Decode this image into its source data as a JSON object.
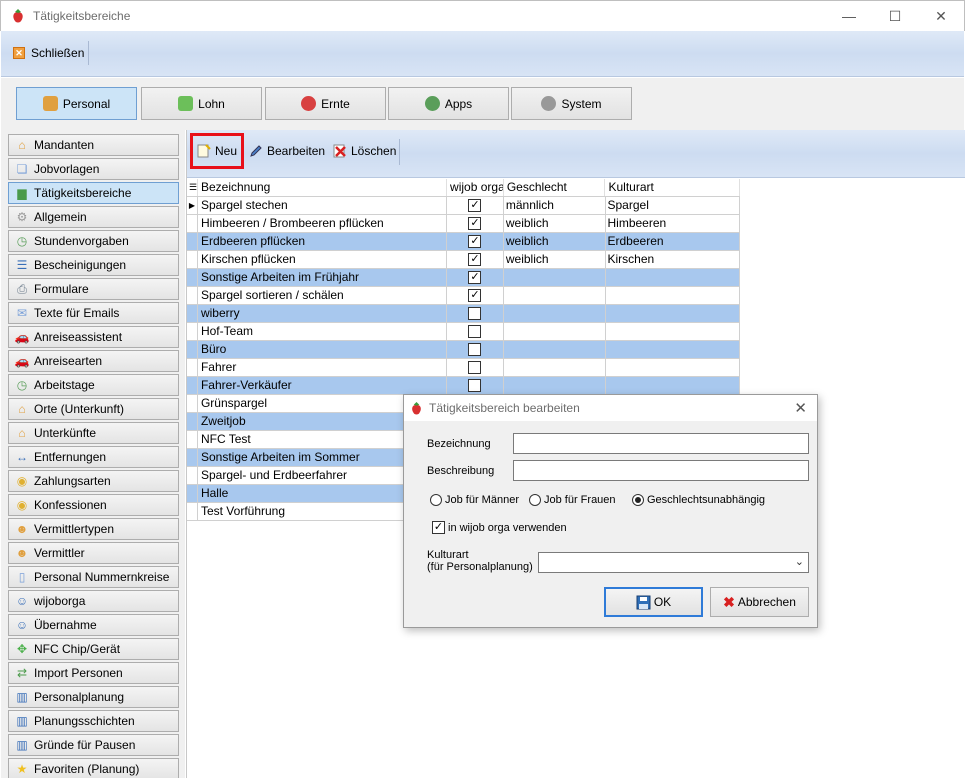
{
  "window": {
    "title": "Tätigkeitsbereiche",
    "minimize": "—",
    "maximize": "☐",
    "close": "✕"
  },
  "topbar": {
    "close_label": "Schließen"
  },
  "main_tabs": [
    {
      "label": "Personal",
      "icon": "people-icon",
      "color": "#e0a040"
    },
    {
      "label": "Lohn",
      "icon": "money-icon",
      "color": "#6cbf5a"
    },
    {
      "label": "Ernte",
      "icon": "strawberry-icon",
      "color": "#d84040"
    },
    {
      "label": "Apps",
      "icon": "apps-icon",
      "color": "#5a9e5a"
    },
    {
      "label": "System",
      "icon": "gear-icon",
      "color": "#999999"
    }
  ],
  "nav": [
    {
      "label": "Mandanten",
      "icon": "house-icon",
      "glyph": "⌂"
    },
    {
      "label": "Jobvorlagen",
      "icon": "template-icon",
      "glyph": "❏"
    },
    {
      "label": "Tätigkeitsbereiche",
      "icon": "area-icon",
      "glyph": "▆"
    },
    {
      "label": "Allgemein",
      "icon": "gear-icon",
      "glyph": "⚙"
    },
    {
      "label": "Stundenvorgaben",
      "icon": "clock-icon",
      "glyph": "◷"
    },
    {
      "label": "Bescheinigungen",
      "icon": "list-icon",
      "glyph": "☰"
    },
    {
      "label": "Formulare",
      "icon": "printer-icon",
      "glyph": "⎙"
    },
    {
      "label": "Texte für Emails",
      "icon": "mail-icon",
      "glyph": "✉"
    },
    {
      "label": "Anreiseassistent",
      "icon": "car-icon",
      "glyph": "🚗"
    },
    {
      "label": "Anreisearten",
      "icon": "car-icon",
      "glyph": "🚗"
    },
    {
      "label": "Arbeitstage",
      "icon": "clock-icon",
      "glyph": "◷"
    },
    {
      "label": "Orte (Unterkunft)",
      "icon": "house-icon",
      "glyph": "⌂"
    },
    {
      "label": "Unterkünfte",
      "icon": "house-icon",
      "glyph": "⌂"
    },
    {
      "label": "Entfernungen",
      "icon": "distance-icon",
      "glyph": "↔"
    },
    {
      "label": "Zahlungsarten",
      "icon": "coins-icon",
      "glyph": "◉"
    },
    {
      "label": "Konfessionen",
      "icon": "coins-icon",
      "glyph": "◉"
    },
    {
      "label": "Vermittlertypen",
      "icon": "people-icon",
      "glyph": "☻"
    },
    {
      "label": "Vermittler",
      "icon": "people-icon",
      "glyph": "☻"
    },
    {
      "label": "Personal Nummernkreise",
      "icon": "document-icon",
      "glyph": "▯"
    },
    {
      "label": "wijoborga",
      "icon": "person-icon",
      "glyph": "☺"
    },
    {
      "label": "Übernahme",
      "icon": "person-icon",
      "glyph": "☺"
    },
    {
      "label": "NFC Chip/Gerät",
      "icon": "nfc-icon",
      "glyph": "✥"
    },
    {
      "label": "Import Personen",
      "icon": "import-icon",
      "glyph": "⇄"
    },
    {
      "label": "Personalplanung",
      "icon": "chart-icon",
      "glyph": "▥"
    },
    {
      "label": "Planungsschichten",
      "icon": "chart-icon",
      "glyph": "▥"
    },
    {
      "label": "Gründe für Pausen",
      "icon": "chart-icon",
      "glyph": "▥"
    },
    {
      "label": "Favoriten (Planung)",
      "icon": "star-icon",
      "glyph": "★"
    }
  ],
  "subtoolbar": {
    "new_label": "Neu",
    "edit_label": "Bearbeiten",
    "delete_label": "Löschen"
  },
  "grid": {
    "headers": [
      "Bezeichnung",
      "wijob orga",
      "Geschlecht",
      "Kulturart"
    ],
    "rows": [
      {
        "name": "Spargel stechen",
        "wijob": true,
        "gender": "männlich",
        "culture": "Spargel"
      },
      {
        "name": "Himbeeren / Brombeeren pflücken",
        "wijob": true,
        "gender": "weiblich",
        "culture": "Himbeeren"
      },
      {
        "name": "Erdbeeren pflücken",
        "wijob": true,
        "gender": "weiblich",
        "culture": "Erdbeeren"
      },
      {
        "name": "Kirschen pflücken",
        "wijob": true,
        "gender": "weiblich",
        "culture": "Kirschen"
      },
      {
        "name": "Sonstige Arbeiten im Frühjahr",
        "wijob": true,
        "gender": "",
        "culture": ""
      },
      {
        "name": "Spargel sortieren / schälen",
        "wijob": true,
        "gender": "",
        "culture": ""
      },
      {
        "name": "wiberry",
        "wijob": false,
        "gender": "",
        "culture": ""
      },
      {
        "name": "Hof-Team",
        "wijob": false,
        "gender": "",
        "culture": ""
      },
      {
        "name": "Büro",
        "wijob": false,
        "gender": "",
        "culture": ""
      },
      {
        "name": "Fahrer",
        "wijob": false,
        "gender": "",
        "culture": ""
      },
      {
        "name": "Fahrer-Verkäufer",
        "wijob": false,
        "gender": "",
        "culture": ""
      },
      {
        "name": "Grünspargel",
        "wijob": null,
        "gender": "",
        "culture": ""
      },
      {
        "name": "Zweitjob",
        "wijob": null,
        "gender": "",
        "culture": ""
      },
      {
        "name": "NFC Test",
        "wijob": null,
        "gender": "",
        "culture": ""
      },
      {
        "name": "Sonstige Arbeiten im Sommer",
        "wijob": null,
        "gender": "",
        "culture": ""
      },
      {
        "name": "Spargel- und Erdbeerfahrer",
        "wijob": null,
        "gender": "",
        "culture": ""
      },
      {
        "name": "Halle",
        "wijob": null,
        "gender": "",
        "culture": ""
      },
      {
        "name": "Test Vorführung",
        "wijob": null,
        "gender": "",
        "culture": ""
      }
    ]
  },
  "dialog": {
    "title": "Tätigkeitsbereich bearbeiten",
    "bezeichnung_label": "Bezeichnung",
    "bezeichnung_value": "",
    "beschreibung_label": "Beschreibung",
    "beschreibung_value": "",
    "radio_men": "Job für Männer",
    "radio_women": "Job für Frauen",
    "radio_neutral": "Geschlechtsunabhängig",
    "checkbox_label": "in wijob orga verwenden",
    "kulturart_label_1": "Kulturart",
    "kulturart_label_2": "(für Personalplanung)",
    "kulturart_value": "",
    "ok_label": "OK",
    "cancel_label": "Abbrechen"
  }
}
